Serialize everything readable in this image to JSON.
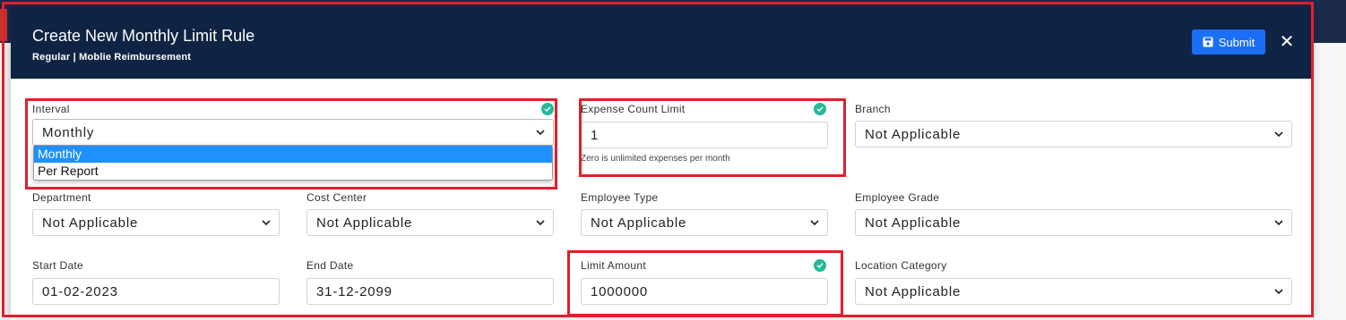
{
  "modal": {
    "title": "Create New Monthly Limit Rule",
    "subtitle": "Regular | Moblie Reimbursement",
    "submit_label": "Submit",
    "close_label": "✕"
  },
  "fields": {
    "interval": {
      "label": "Interval",
      "value": "Monthly",
      "options": [
        "Monthly",
        "Per Report"
      ],
      "selected": "Monthly"
    },
    "expense_count_limit": {
      "label": "Expense Count Limit",
      "value": "1",
      "help": "Zero is unlimited expenses per month"
    },
    "branch": {
      "label": "Branch",
      "value": "Not Applicable"
    },
    "department": {
      "label": "Department",
      "value": "Not Applicable"
    },
    "cost_center": {
      "label": "Cost Center",
      "value": "Not Applicable"
    },
    "employee_type": {
      "label": "Employee Type",
      "value": "Not Applicable"
    },
    "employee_grade": {
      "label": "Employee Grade",
      "value": "Not Applicable"
    },
    "start_date": {
      "label": "Start Date",
      "value": "01-02-2023"
    },
    "end_date": {
      "label": "End Date",
      "value": "31-12-2099"
    },
    "limit_amount": {
      "label": "Limit Amount",
      "value": "1000000"
    },
    "location_category": {
      "label": "Location Category",
      "value": "Not Applicable"
    }
  },
  "colors": {
    "header": "#0f2444",
    "primary": "#1a6ff5",
    "success": "#26b99a",
    "highlight": "#e0202a"
  }
}
